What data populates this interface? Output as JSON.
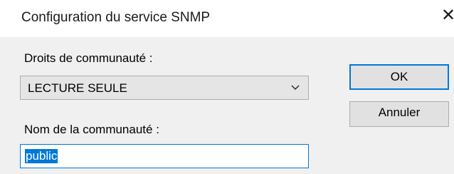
{
  "window": {
    "title": "Configuration du service SNMP",
    "close_symbol": "✕"
  },
  "form": {
    "rights_label": "Droits de communauté :",
    "rights_value": "LECTURE SEULE",
    "name_label": "Nom de la communauté :",
    "name_value": "public"
  },
  "buttons": {
    "ok_label": "OK",
    "cancel_label": "Annuler"
  },
  "colors": {
    "accent": "#0078d7",
    "panel": "#f0f0f0"
  }
}
